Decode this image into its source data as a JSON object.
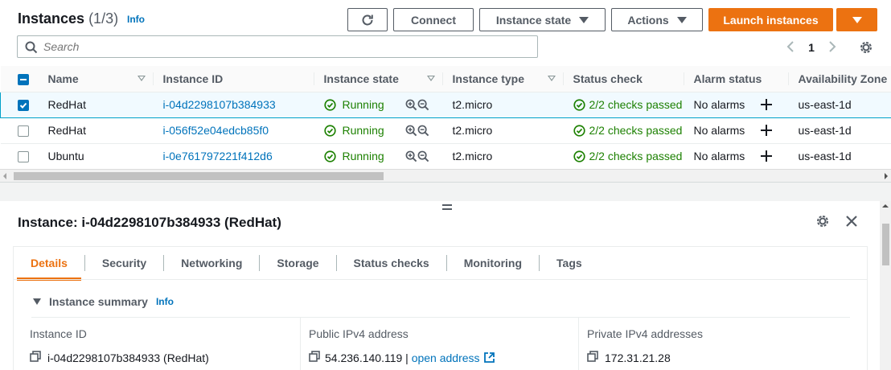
{
  "header": {
    "title": "Instances",
    "count": "(1/3)",
    "info": "Info"
  },
  "toolbar": {
    "connect": "Connect",
    "instance_state": "Instance state",
    "actions": "Actions",
    "launch": "Launch instances"
  },
  "search": {
    "placeholder": "Search"
  },
  "pagination": {
    "current_page": "1"
  },
  "table": {
    "headers": {
      "name": "Name",
      "instance_id": "Instance ID",
      "instance_state": "Instance state",
      "instance_type": "Instance type",
      "status_check": "Status check",
      "alarm_status": "Alarm status",
      "availability_zone": "Availability Zone"
    },
    "rows": [
      {
        "selected": true,
        "name": "RedHat",
        "instance_id": "i-04d2298107b384933",
        "state": "Running",
        "type": "t2.micro",
        "status_check": "2/2 checks passed",
        "alarm": "No alarms",
        "az": "us-east-1d"
      },
      {
        "selected": false,
        "name": "RedHat",
        "instance_id": "i-056f52e04edcb85f0",
        "state": "Running",
        "type": "t2.micro",
        "status_check": "2/2 checks passed",
        "alarm": "No alarms",
        "az": "us-east-1d"
      },
      {
        "selected": false,
        "name": "Ubuntu",
        "instance_id": "i-0e761797221f412d6",
        "state": "Running",
        "type": "t2.micro",
        "status_check": "2/2 checks passed",
        "alarm": "No alarms",
        "az": "us-east-1d"
      }
    ]
  },
  "detail": {
    "title": "Instance: i-04d2298107b384933 (RedHat)",
    "tabs": [
      "Details",
      "Security",
      "Networking",
      "Storage",
      "Status checks",
      "Monitoring",
      "Tags"
    ],
    "active_tab": "Details",
    "summary": {
      "heading": "Instance summary",
      "info": "Info",
      "instance_id_label": "Instance ID",
      "instance_id_value": "i-04d2298107b384933 (RedHat)",
      "public_ip_label": "Public IPv4 address",
      "public_ip_value": "54.236.140.119",
      "public_ip_separator": "|",
      "open_address": "open address",
      "private_ip_label": "Private IPv4 addresses",
      "private_ip_value": "172.31.21.28"
    }
  },
  "colors": {
    "accent_orange": "#ec7211",
    "link_blue": "#0073bb",
    "success_green": "#1d8102",
    "text_dark": "#16191f",
    "text_muted": "#545b64"
  },
  "icons": {
    "refresh": "refresh-icon",
    "search": "search-icon",
    "settings": "gear-icon",
    "close": "close-icon",
    "status_ok": "check-circle-icon",
    "zoom_in": "zoom-in-icon",
    "zoom_out": "zoom-out-icon",
    "add": "plus-icon",
    "copy": "copy-icon",
    "external": "external-link-icon"
  }
}
